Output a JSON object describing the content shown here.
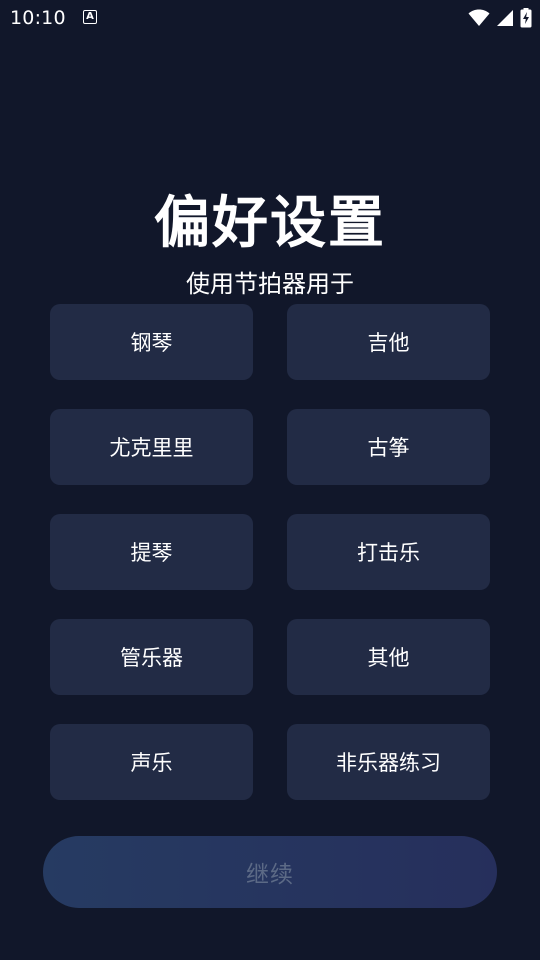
{
  "status_bar": {
    "time": "10:10",
    "notification_icon": "A"
  },
  "header": {
    "title": "偏好设置",
    "subtitle": "使用节拍器用于"
  },
  "options": [
    {
      "label": "钢琴"
    },
    {
      "label": "吉他"
    },
    {
      "label": "尤克里里"
    },
    {
      "label": "古筝"
    },
    {
      "label": "提琴"
    },
    {
      "label": "打击乐"
    },
    {
      "label": "管乐器"
    },
    {
      "label": "其他"
    },
    {
      "label": "声乐"
    },
    {
      "label": "非乐器练习"
    }
  ],
  "actions": {
    "continue_label": "继续"
  },
  "colors": {
    "background": "#11172a",
    "option_background": "#222b45",
    "continue_text": "#5c6a86"
  }
}
